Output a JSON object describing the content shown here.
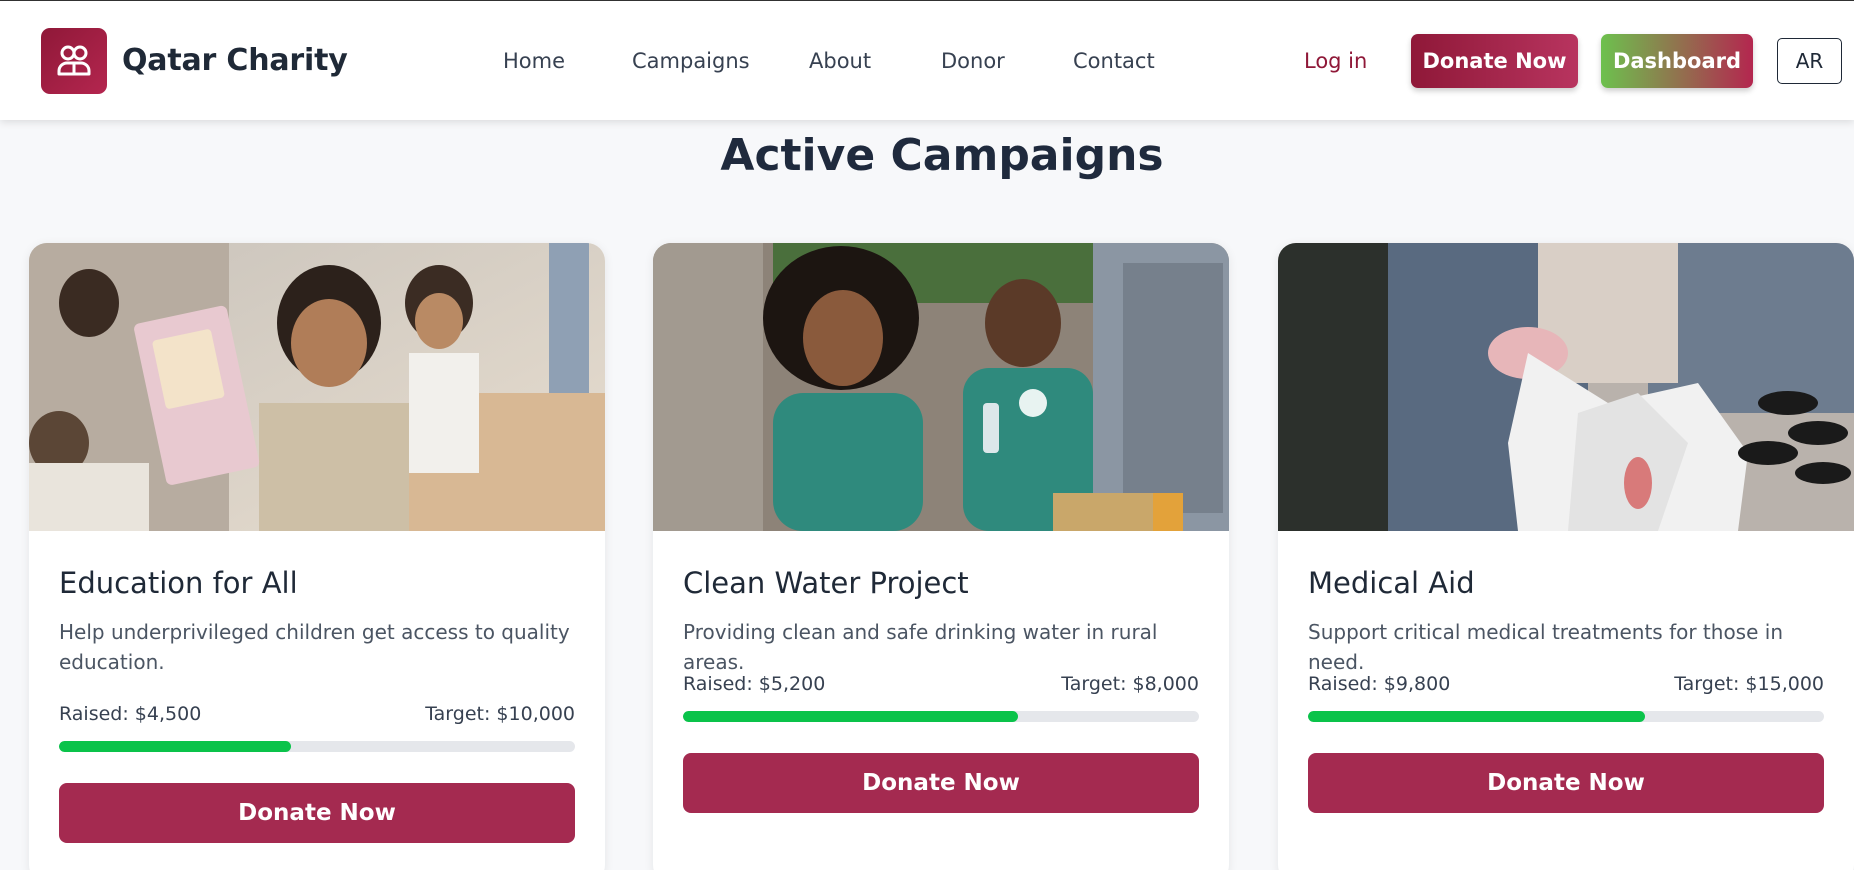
{
  "header": {
    "brand": "Qatar Charity",
    "logo_icon": "people-icon",
    "nav": [
      "Home",
      "Campaigns",
      "About",
      "Donor",
      "Contact"
    ],
    "login": "Log in",
    "donate": "Donate Now",
    "dashboard": "Dashboard",
    "lang": "AR",
    "colors": {
      "brand": "#8f1838",
      "accent_green": "#6dc14e"
    }
  },
  "section": {
    "title": "Active Campaigns"
  },
  "campaigns": [
    {
      "title": "Education for All",
      "description": "Help underprivileged children get access to quality education.",
      "raised": "Raised: $4,500",
      "target": "Target: $10,000",
      "progress": 0.45,
      "button": "Donate Now",
      "image": "children-with-books-photo"
    },
    {
      "title": "Clean Water Project",
      "description": "Providing clean and safe drinking water in rural areas.",
      "raised": "Raised: $5,200",
      "target": "Target: $8,000",
      "progress": 0.65,
      "button": "Donate Now",
      "image": "volunteers-water-bottle-photo"
    },
    {
      "title": "Medical Aid",
      "description": "Support critical medical treatments for those in need.",
      "raised": "Raised: $9,800",
      "target": "Target: $15,000",
      "progress": 0.6533,
      "button": "Donate Now",
      "image": "volunteers-packing-aid-photo"
    }
  ]
}
